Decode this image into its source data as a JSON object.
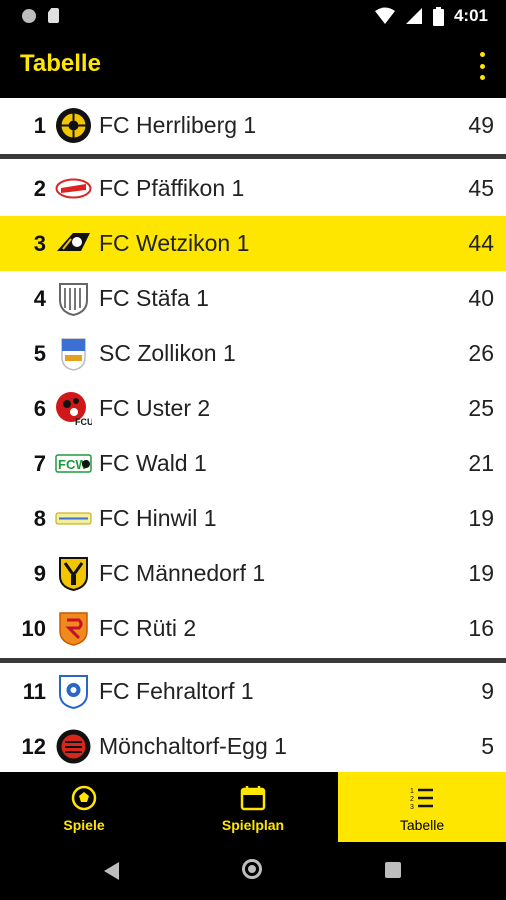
{
  "status_bar": {
    "time": "4:01"
  },
  "app_bar": {
    "title": "Tabelle"
  },
  "table": {
    "rows": [
      {
        "rank": "1",
        "team": "FC Herrliberg 1",
        "points": "49",
        "crest": "herrliberg-crest"
      },
      {
        "rank": "2",
        "team": "FC Pfäffikon 1",
        "points": "45",
        "crest": "pfaeffikon-crest"
      },
      {
        "rank": "3",
        "team": "FC Wetzikon 1",
        "points": "44",
        "crest": "wetzikon-crest",
        "highlight": true
      },
      {
        "rank": "4",
        "team": "FC Stäfa 1",
        "points": "40",
        "crest": "staefa-crest"
      },
      {
        "rank": "5",
        "team": "SC Zollikon 1",
        "points": "26",
        "crest": "zollikon-crest"
      },
      {
        "rank": "6",
        "team": "FC Uster 2",
        "points": "25",
        "crest": "uster-crest"
      },
      {
        "rank": "7",
        "team": "FC Wald 1",
        "points": "21",
        "crest": "wald-crest"
      },
      {
        "rank": "8",
        "team": "FC Hinwil 1",
        "points": "19",
        "crest": "hinwil-crest"
      },
      {
        "rank": "9",
        "team": "FC Männedorf 1",
        "points": "19",
        "crest": "maennedorf-crest"
      },
      {
        "rank": "10",
        "team": "FC Rüti 2",
        "points": "16",
        "crest": "rueti-crest"
      },
      {
        "rank": "11",
        "team": "FC Fehraltorf 1",
        "points": "9",
        "crest": "fehraltorf-crest"
      },
      {
        "rank": "12",
        "team": "Mönchaltorf-Egg 1",
        "points": "5",
        "crest": "moenchaltorf-crest"
      }
    ]
  },
  "bottom_nav": {
    "items": [
      {
        "label": "Spiele",
        "icon": "soccer-ball-icon"
      },
      {
        "label": "Spielplan",
        "icon": "calendar-icon"
      },
      {
        "label": "Tabelle",
        "icon": "list-icon",
        "active": true
      }
    ]
  },
  "colors": {
    "accent": "#ffe600",
    "bar": "#000000"
  }
}
